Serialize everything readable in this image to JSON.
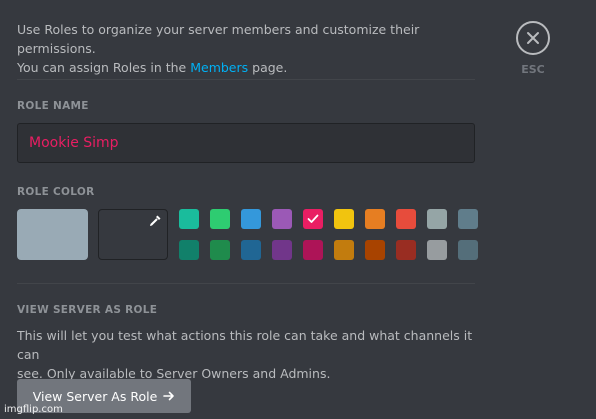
{
  "intro": {
    "line1": "Use Roles to organize your server members and customize their permissions.",
    "line2_prefix": "You can assign Roles in the ",
    "members_link": "Members",
    "line2_suffix": " page."
  },
  "close": {
    "label": "ESC",
    "icon": "close-icon"
  },
  "role_name": {
    "title": "ROLE NAME",
    "value": "Mookie Simp",
    "value_color": "#e91e63"
  },
  "role_color": {
    "title": "ROLE COLOR",
    "default_color": "#99aab5",
    "custom_icon": "eyedropper-icon",
    "selected_index": 4,
    "swatches": [
      "#1abc9c",
      "#2ecc71",
      "#3498db",
      "#9b59b6",
      "#e91e63",
      "#f1c40f",
      "#e67e22",
      "#e74c3c",
      "#95a5a6",
      "#607d8b",
      "#11806a",
      "#1f8b4c",
      "#206694",
      "#71368a",
      "#ad1457",
      "#c27c0e",
      "#a84300",
      "#992d22",
      "#979c9f",
      "#546e7a"
    ]
  },
  "view_as_role": {
    "title": "VIEW SERVER AS ROLE",
    "description_line1": "This will let you test what actions this role can take and what channels it can",
    "description_line2": "see. Only available to Server Owners and Admins.",
    "button_label": "View Server As Role",
    "button_icon": "arrow-right-icon"
  },
  "watermark": "imgflip.com"
}
